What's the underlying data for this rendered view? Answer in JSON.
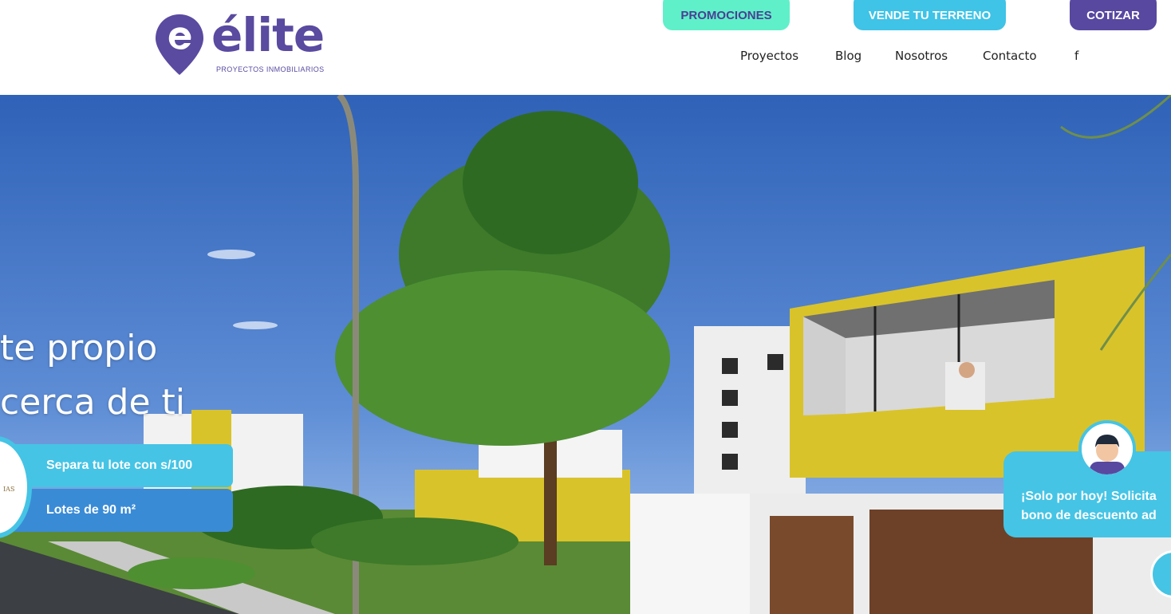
{
  "brand": {
    "name": "élite",
    "tagline": "PROYECTOS INMOBILIARIOS",
    "color": "#5a4aa0"
  },
  "header": {
    "pills": {
      "promociones": "PROMOCIONES",
      "vende": "VENDE TU TERRENO",
      "cotizar": "COTIZAR"
    },
    "nav": {
      "proyectos": "Proyectos",
      "blog": "Blog",
      "nosotros": "Nosotros",
      "contacto": "Contacto",
      "facebook": "f"
    }
  },
  "hero": {
    "headline_line1": "te propio",
    "headline_line2": "cerca de ti",
    "tag1": "Separa tu lote con s/100",
    "tag2": "Lotes de 90 m²",
    "badge_text": "IAS"
  },
  "promo_card": {
    "line1": "¡Solo por hoy! Solicita",
    "line2": "bono de descuento ad"
  },
  "colors": {
    "mint": "#5ff0c9",
    "cyan": "#45c4e5",
    "blue": "#3a8bd6",
    "purple": "#5848a0",
    "yellow": "#d9c32a"
  }
}
